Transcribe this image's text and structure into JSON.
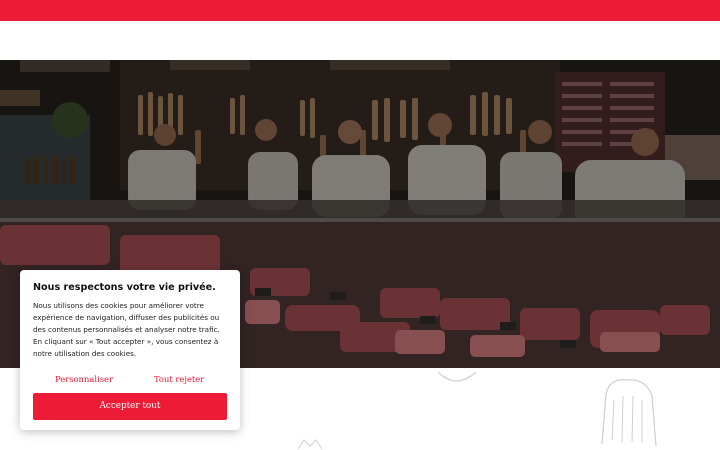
{
  "colors": {
    "brand_red": "#ee1b36",
    "link_red": "#e01c38",
    "banner_bg": "#ffffff"
  },
  "hero": {
    "image_subject": "butcher-shop-staff-behind-meat-counter"
  },
  "cookie_banner": {
    "title": "Nous respectons votre vie privée.",
    "text": "Nous utilisons des cookies pour améliorer votre expérience de navigation, diffuser des publicités ou des contenus personnalisés et analyser notre trafic. En cliquant sur « Tout accepter », vous consentez à notre utilisation des cookies.",
    "customize_label": "Personnaliser",
    "reject_label": "Tout rejeter",
    "accept_label": "Accepter tout"
  }
}
